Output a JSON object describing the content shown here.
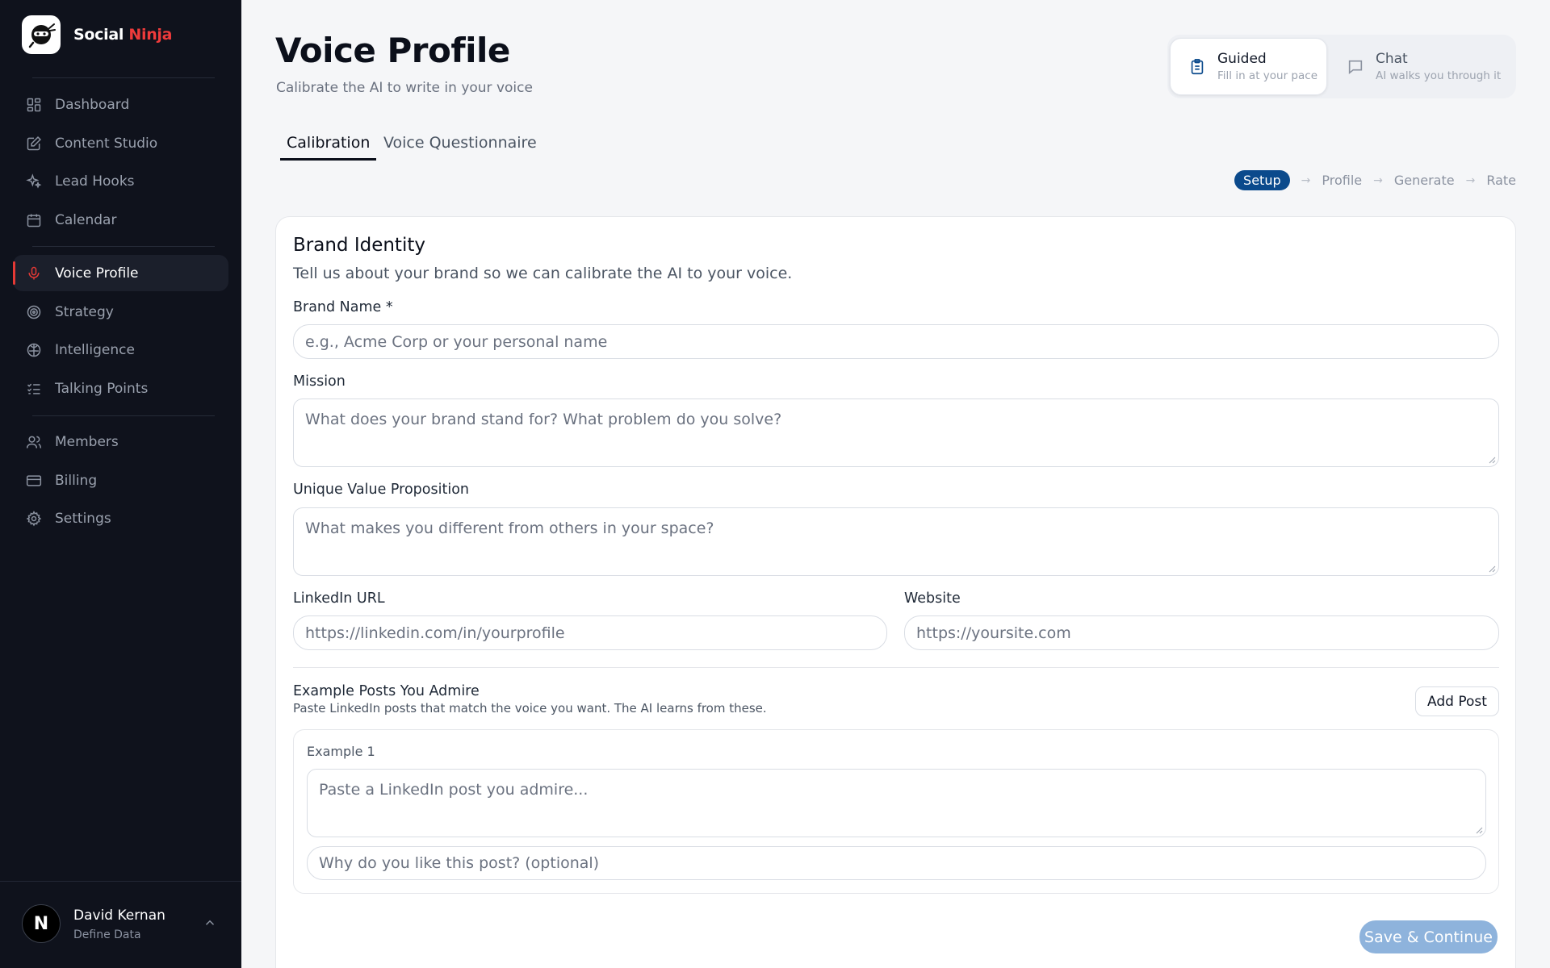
{
  "brand": {
    "name_part1": "Social",
    "name_part2": "Ninja"
  },
  "sidebar": {
    "items": [
      {
        "label": "Dashboard",
        "icon": "dashboard-icon"
      },
      {
        "label": "Content Studio",
        "icon": "edit-icon"
      },
      {
        "label": "Lead Hooks",
        "icon": "sparkles-icon"
      },
      {
        "label": "Calendar",
        "icon": "calendar-icon"
      },
      {
        "label": "Voice Profile",
        "icon": "microphone-icon",
        "active": true
      },
      {
        "label": "Strategy",
        "icon": "target-icon"
      },
      {
        "label": "Intelligence",
        "icon": "brain-icon"
      },
      {
        "label": "Talking Points",
        "icon": "checklist-icon"
      },
      {
        "label": "Members",
        "icon": "users-icon"
      },
      {
        "label": "Billing",
        "icon": "credit-card-icon"
      },
      {
        "label": "Settings",
        "icon": "gear-icon"
      }
    ]
  },
  "user": {
    "initial": "N",
    "name": "David Kernan",
    "org": "Define Data"
  },
  "header": {
    "title": "Voice Profile",
    "subtitle": "Calibrate the AI to write in your voice"
  },
  "modes": [
    {
      "title": "Guided",
      "desc": "Fill in at your pace",
      "active": true,
      "icon": "clipboard-icon"
    },
    {
      "title": "Chat",
      "desc": "AI walks you through it",
      "active": false,
      "icon": "chat-icon"
    }
  ],
  "tabs": [
    {
      "label": "Calibration",
      "active": true
    },
    {
      "label": "Voice Questionnaire",
      "active": false
    }
  ],
  "steps": [
    "Setup",
    "Profile",
    "Generate",
    "Rate"
  ],
  "steps_arrow": "→",
  "form": {
    "title": "Brand Identity",
    "description": "Tell us about your brand so we can calibrate the AI to your voice.",
    "brand_name_label": "Brand Name *",
    "brand_name_placeholder": "e.g., Acme Corp or your personal name",
    "mission_label": "Mission",
    "mission_placeholder": "What does your brand stand for? What problem do you solve?",
    "uvp_label": "Unique Value Proposition",
    "uvp_placeholder": "What makes you different from others in your space?",
    "linkedin_label": "LinkedIn URL",
    "linkedin_placeholder": "https://linkedin.com/in/yourprofile",
    "website_label": "Website",
    "website_placeholder": "https://yoursite.com",
    "examples_title": "Example Posts You Admire",
    "examples_desc": "Paste LinkedIn posts that match the voice you want. The AI learns from these.",
    "add_post_label": "Add Post",
    "example_label": "Example 1",
    "example_post_placeholder": "Paste a LinkedIn post you admire...",
    "example_why_placeholder": "Why do you like this post? (optional)",
    "save_label": "Save & Continue"
  },
  "colors": {
    "sidebar_bg": "#0f121c",
    "accent_red": "#e53935",
    "step_active": "#0b4a8c",
    "save_button": "#8eb3dc"
  }
}
